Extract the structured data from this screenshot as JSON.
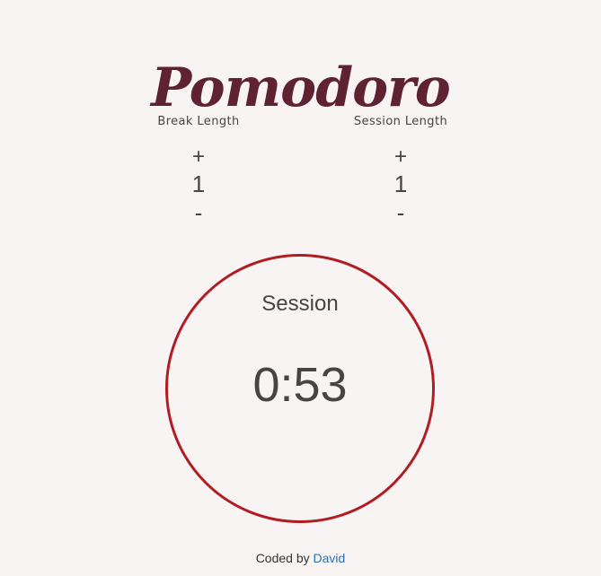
{
  "app": {
    "title": "Pomodoro"
  },
  "break_control": {
    "label": "Break Length",
    "increment": "+",
    "value": "1",
    "decrement": "-"
  },
  "session_control": {
    "label": "Session Length",
    "increment": "+",
    "value": "1",
    "decrement": "-"
  },
  "timer": {
    "label": "Session",
    "time": "0:53"
  },
  "footer": {
    "prefix": "Coded by",
    "author": "David"
  },
  "colors": {
    "background": "#f8f4f4",
    "title": "#5e2230",
    "ring": "#b01e23",
    "text": "#4a4440",
    "link": "#2a70b0"
  }
}
